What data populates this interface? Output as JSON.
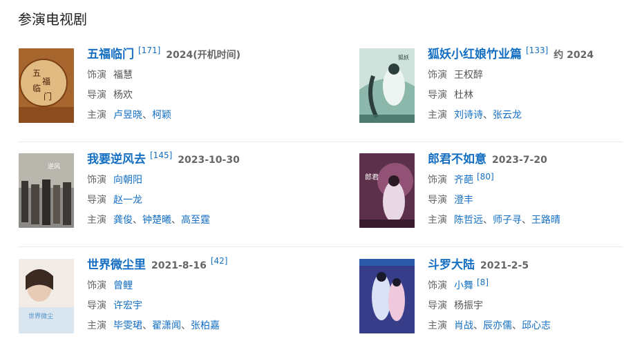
{
  "section": {
    "title": "参演电视剧"
  },
  "labels": {
    "role": "饰演",
    "director": "导演",
    "cast": "主演"
  },
  "dramas": [
    {
      "title": "五福临门",
      "ref": "[171]",
      "date": "2024(开机时间)",
      "role": "福慧",
      "role_ref": "",
      "director": "杨欢",
      "cast": [
        "卢昱晓",
        "柯颖"
      ]
    },
    {
      "title": "狐妖小红娘竹业篇",
      "ref": "[133]",
      "date": "约 2024",
      "role": "王权醉",
      "role_ref": "",
      "director": "杜林",
      "cast": [
        "刘诗诗",
        "张云龙"
      ]
    },
    {
      "title": "我要逆风去",
      "ref": "[145]",
      "date": "2023-10-30",
      "role": "向朝阳",
      "role_ref": "",
      "director": "赵一龙",
      "cast": [
        "龚俊",
        "钟楚曦",
        "高至霆"
      ]
    },
    {
      "title": "郎君不如意",
      "ref": "",
      "date": "2023-7-20",
      "role": "齐葩",
      "role_ref": "[80]",
      "director": "澄丰",
      "cast": [
        "陈哲远",
        "师子寻",
        "王路晴"
      ]
    },
    {
      "title": "世界微尘里",
      "ref": "",
      "date": "2021-8-16",
      "date_ref": "[42]",
      "role": "曾鲤",
      "role_ref": "",
      "director": "许宏宇",
      "cast": [
        "毕雯珺",
        "翟潇闻",
        "张柏嘉"
      ]
    },
    {
      "title": "斗罗大陆",
      "ref": "",
      "date": "2021-2-5",
      "role": "小舞",
      "role_ref": "[8]",
      "director": "杨振宇",
      "cast": [
        "肖战",
        "辰亦儒",
        "邱心志"
      ]
    }
  ],
  "colors": {
    "link": "#136ec2",
    "label": "#666666"
  }
}
